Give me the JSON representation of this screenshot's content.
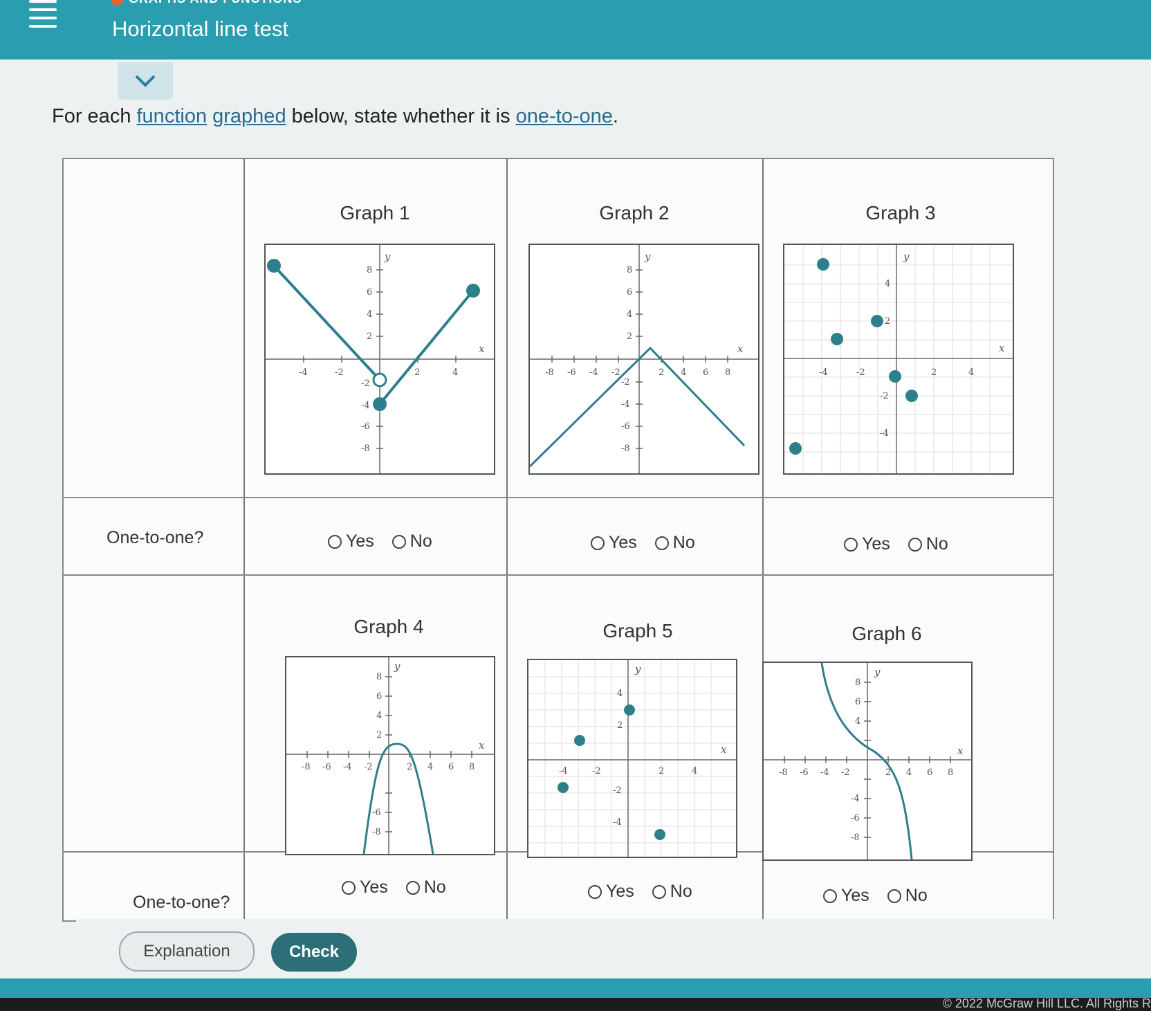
{
  "header": {
    "category": "GRAPHS AND FUNCTIONS",
    "title": "Horizontal line test"
  },
  "instruction": {
    "prefix": "For each ",
    "link1": "function",
    "space": " ",
    "link2": "graphed",
    "middle": " below, state whether it is ",
    "link3": "one-to-one",
    "suffix": "."
  },
  "row_label": "One-to-one?",
  "graphs": [
    {
      "title": "Graph 1"
    },
    {
      "title": "Graph 2"
    },
    {
      "title": "Graph 3"
    },
    {
      "title": "Graph 4"
    },
    {
      "title": "Graph 5"
    },
    {
      "title": "Graph 6"
    }
  ],
  "options": {
    "yes": "Yes",
    "no": "No"
  },
  "buttons": {
    "explanation": "Explanation",
    "check": "Check"
  },
  "footer": {
    "copyright": "© 2022 McGraw Hill LLC. All Rights R"
  },
  "colors": {
    "accent": "#2a9db0",
    "curve": "#2e7f8c",
    "check": "#2c6f78",
    "category_dot": "#e8622a"
  }
}
